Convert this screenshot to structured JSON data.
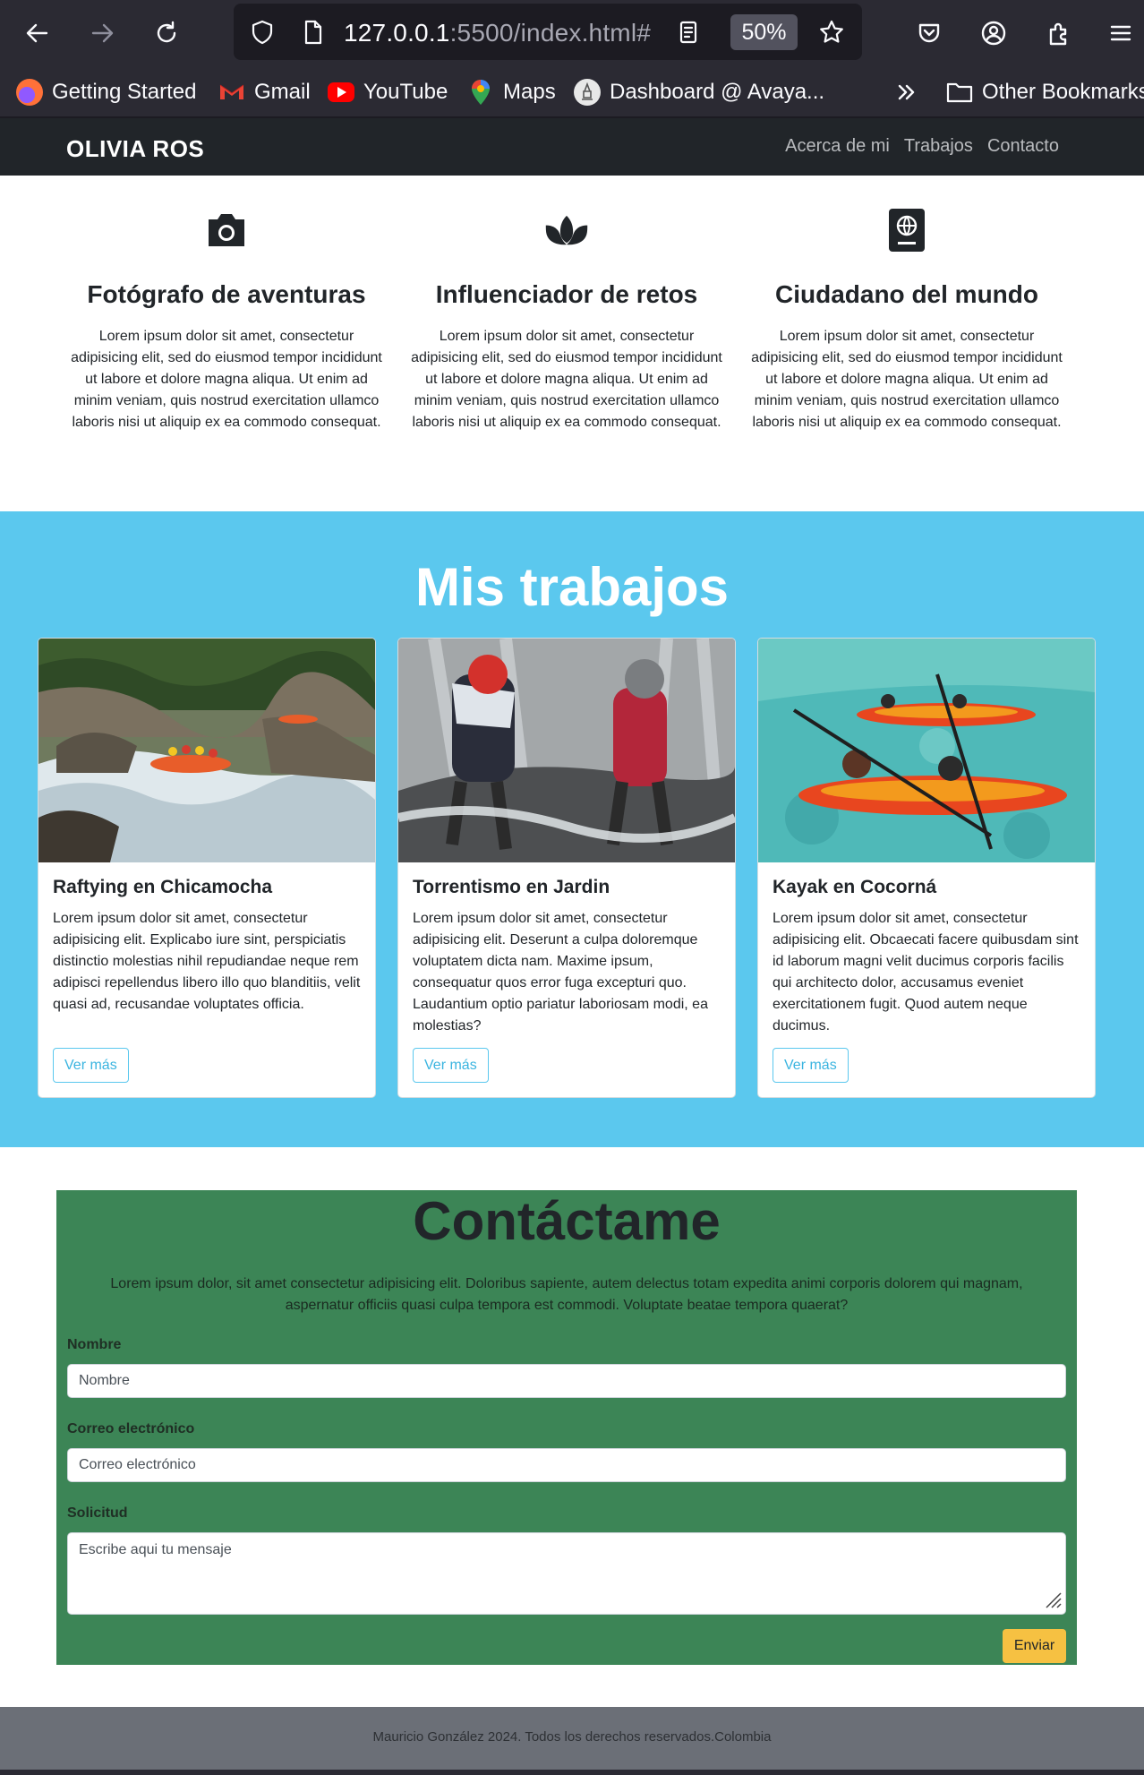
{
  "browser": {
    "url_host": "127.0.0.1",
    "url_rest": ":5500/index.html#",
    "zoom": "50%",
    "bookmarks": [
      {
        "label": "Getting Started",
        "icon": "firefox-icon"
      },
      {
        "label": "Gmail",
        "icon": "gmail-icon"
      },
      {
        "label": "YouTube",
        "icon": "youtube-icon"
      },
      {
        "label": "Maps",
        "icon": "maps-icon"
      },
      {
        "label": "Dashboard @ Avaya...",
        "icon": "dashboard-icon"
      }
    ],
    "other_bookmarks": "Other Bookmarks"
  },
  "navbar": {
    "brand": "OLIVIA ROS",
    "links": [
      "Acerca de mi",
      "Trabajos",
      "Contacto"
    ]
  },
  "features": [
    {
      "icon": "camera-icon",
      "title": "Fotógrafo de aventuras",
      "text": "Lorem ipsum dolor sit amet, consectetur adipisicing elit, sed do eiusmod tempor incididunt ut labore et dolore magna aliqua. Ut enim ad minim veniam, quis nostrud exercitation ullamco laboris nisi ut aliquip ex ea commodo consequat."
    },
    {
      "icon": "lotus-icon",
      "title": "Influenciador de retos",
      "text": "Lorem ipsum dolor sit amet, consectetur adipisicing elit, sed do eiusmod tempor incididunt ut labore et dolore magna aliqua. Ut enim ad minim veniam, quis nostrud exercitation ullamco laboris nisi ut aliquip ex ea commodo consequat."
    },
    {
      "icon": "passport-icon",
      "title": "Ciudadano del mundo",
      "text": "Lorem ipsum dolor sit amet, consectetur adipisicing elit, sed do eiusmod tempor incididunt ut labore et dolore magna aliqua. Ut enim ad minim veniam, quis nostrud exercitation ullamco laboris nisi ut aliquip ex ea commodo consequat."
    }
  ],
  "works": {
    "title": "Mis trabajos",
    "cards": [
      {
        "image": "rafting-photo",
        "title": "Raftying en Chicamocha",
        "text": "Lorem ipsum dolor sit amet, consectetur adipisicing elit. Explicabo iure sint, perspiciatis distinctio molestias nihil repudiandae neque rem adipisci repellendus libero illo quo blanditiis, velit quasi ad, recusandae voluptates officia.",
        "button": "Ver más"
      },
      {
        "image": "canyoning-photo",
        "title": "Torrentismo en Jardin",
        "text": "Lorem ipsum dolor sit amet, consectetur adipisicing elit. Deserunt a culpa doloremque voluptatem dicta nam. Maxime ipsum, consequatur quos error fuga excepturi quo. Laudantium optio pariatur laboriosam modi, ea molestias?",
        "button": "Ver más"
      },
      {
        "image": "kayak-photo",
        "title": "Kayak en Cocorná",
        "text": "Lorem ipsum dolor sit amet, consectetur adipisicing elit. Obcaecati facere quibusdam sint id laborum magni velit ducimus corporis facilis qui architecto dolor, accusamus eveniet exercitationem fugit. Quod autem neque ducimus.",
        "button": "Ver más"
      }
    ]
  },
  "contact": {
    "title": "Contáctame",
    "intro": "Lorem ipsum dolor, sit amet consectetur adipisicing elit. Doloribus sapiente, autem delectus totam expedita animi corporis dolorem qui magnam, aspernatur officiis quasi culpa tempora est commodi. Voluptate beatae tempora quaerat?",
    "name_label": "Nombre",
    "name_placeholder": "Nombre",
    "email_label": "Correo electrónico",
    "email_placeholder": "Correo electrónico",
    "message_label": "Solicitud",
    "message_placeholder": "Escribe aqui tu mensaje",
    "submit": "Enviar"
  },
  "footer": {
    "text": "Mauricio González 2024. Todos los derechos reservados.Colombia"
  },
  "colors": {
    "navbar": "#212529",
    "works_bg": "#5bc8ee",
    "contact_bg": "#3c8556",
    "submit_button": "#f6c142",
    "footer_bg": "#6b6f77"
  }
}
